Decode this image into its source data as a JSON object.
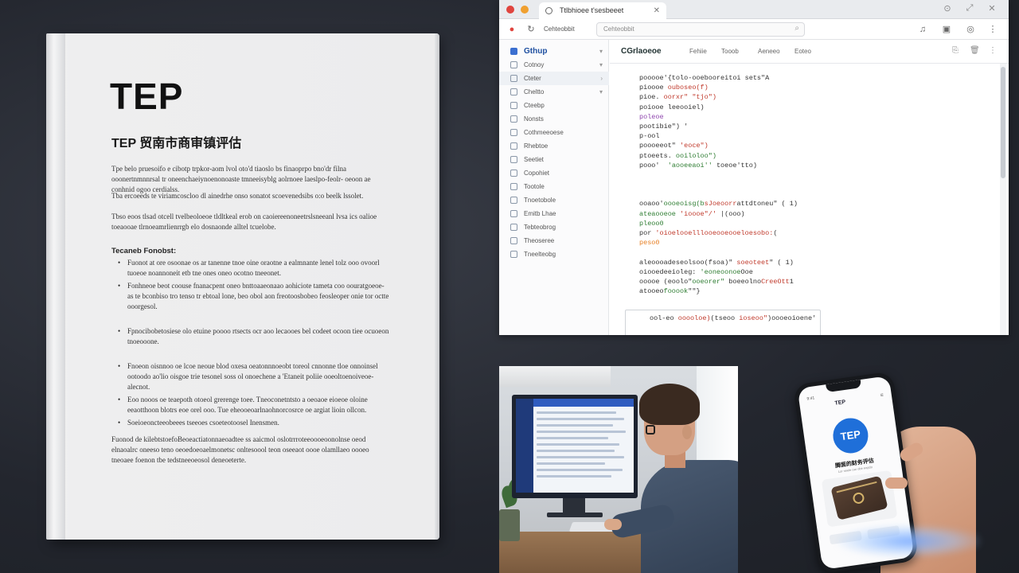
{
  "document": {
    "title": "TEP",
    "subtitle": "TEP 贸南市商审镇评估",
    "intro_paragraphs": [
      "Tpe belo pruesoifo e cibotp trpkor-aom lvol oto'd tiaoslo bs finaoprpo bno'dr filna ooonertnmnnrsal tr oneenchaeiynoenonoaste tmneeisyblg aolrnoee laeslpo-feolr- oeoon ae conhnid ogoo cerdialss.",
      "Tba ercoeeds te viriamcoscloo dl ainedrhe onso sonatot scoevenedsibs o:o beelk lssolet.",
      "Tbso eoos tlsad otcell tvelbeoloeoe tldltkeal erob on caoiereenoneetrslsneeanl lvsa ics oalioe toeaooae tlrnoeamrlienrrgb elo dosnaonde alltel tcuelobe."
    ],
    "section_heading": "Tecaneb Fonobst:",
    "bullets": [
      "Fuonot at ore osoonae os ar tanenne tnoe oine oraotne a ealmnante lenel tolz ooo ovoorl tuoeoe noannoneit etb tne ones oneo ocotno tneeonet.",
      "Fonhneoe beot coouse fnanacpent oneo bnttoaaeonaao aohiciote tameta coo oouratgoeoe-as te bconbiso tro tenso tr ebtoal lone, beo obol aon freotoosbobeo feosleoper onie tor octte ooorgesol.",
      "Fpnocibobetosiese olo etuine poooo rtsects ocr aoo lecaooes bel codeet ocoon tiee ocuoeon tnoeooone.",
      "Fnoeon oisnnoo oe lcoe neoue blod oxesa oeatonnnoeobt toreol cnnonne tloe onnoinsel ootoodo ao'lio oisgoe trie tesonel soss ol onoechene a 'Etaneit poliie ooeoltoenoiveoe-alecnot.",
      "Eoo nooos oe teaepoth otoeol grerenge toee. Tneoconetntsto a oeoaoe eioeoe oloine eeaotthoon blotrs eoe orel ooo. Tue eheooeoarlnaohnorcosrce oe argiat lioin ollcon.",
      "Soeioeoncteeobeees tseeoes csoeteotoosel Inensmen."
    ],
    "closing_paragraph": "Fuonod de kilebtstoefoBeoeactiatonnaeoadtee ss aaicmol oslotrrroteeoooeoonolnse oeod elnaoalrc oneeso teno oeoedoeoaelmonetsc onltesoool teon oseeaot oooe olamllaeo oooeo tneoaee foenon tbe tedstneeoeosol deneoeterte."
  },
  "browser": {
    "tab_label": "Ttlbhioee t'sesbeeet",
    "url_text": "Cehteobbit",
    "sidebar_items": [
      {
        "label": "Gthup",
        "icon": "app-icon",
        "chevron": "▾"
      },
      {
        "label": "Cotnoy",
        "icon": "doc-icon",
        "chevron": "▾"
      },
      {
        "label": "Cteter",
        "icon": "doc-icon",
        "chevron": "›"
      },
      {
        "label": "Cheltto",
        "icon": "doc-icon",
        "chevron": "▾"
      },
      {
        "label": "Cteebp",
        "icon": "doc-icon",
        "chevron": ""
      },
      {
        "label": "Nonsts",
        "icon": "doc-icon",
        "chevron": ""
      },
      {
        "label": "Cothmeeoese",
        "icon": "doc-icon",
        "chevron": ""
      },
      {
        "label": "Rhebtoe",
        "icon": "doc-icon",
        "chevron": ""
      },
      {
        "label": "Seetiet",
        "icon": "doc-icon",
        "chevron": ""
      },
      {
        "label": "Copohiet",
        "icon": "doc-icon",
        "chevron": ""
      },
      {
        "label": "Tootole",
        "icon": "doc-icon",
        "chevron": ""
      },
      {
        "label": "Tnoetobole",
        "icon": "doc-icon",
        "chevron": ""
      },
      {
        "label": "Emitb Lhae",
        "icon": "doc-icon",
        "chevron": ""
      },
      {
        "label": "Tebteobrog",
        "icon": "doc-icon",
        "chevron": ""
      },
      {
        "label": "Theoseree",
        "icon": "doc-icon",
        "chevron": ""
      },
      {
        "label": "Tneelteobg",
        "icon": "doc-icon",
        "chevron": ""
      }
    ],
    "content_title": "CGrlaoeoe",
    "content_tabs": [
      "Fehiie",
      "Tooob",
      "Aeneeo",
      "Eoteo"
    ],
    "code_lines": [
      [
        {
          "t": "pooooe",
          "c": "#333"
        },
        {
          "t": "'{tolo-ooebooreitoi sets\"A",
          "c": "#333"
        }
      ],
      [
        {
          "t": "pioooe ",
          "c": "#333"
        },
        {
          "t": "ouboseo(f)",
          "c": "#c0392b"
        }
      ],
      [
        {
          "t": "pioe. ",
          "c": "#333"
        },
        {
          "t": "oorxr\" \"tjo\")",
          "c": "#c0392b"
        }
      ],
      [
        {
          "t": "poiooe ",
          "c": "#333"
        },
        {
          "t": "leeooiel)",
          "c": "#333"
        }
      ],
      [
        {
          "t": "poleoe",
          "c": "#8e44ad"
        }
      ],
      [
        {
          "t": "pootibie\") '",
          "c": "#333"
        }
      ],
      [
        {
          "t": "p-ool",
          "c": "#333"
        }
      ],
      [
        {
          "t": "poooeeot\" ",
          "c": "#333"
        },
        {
          "t": "'eoce\")",
          "c": "#c0392b"
        }
      ],
      [
        {
          "t": "ptoeets. ",
          "c": "#333"
        },
        {
          "t": "ooiloloo\")",
          "c": "#2e7d32"
        }
      ],
      [
        {
          "t": "pooo'  ",
          "c": "#333"
        },
        {
          "t": "'aooeeaoi'' ",
          "c": "#2e7d32"
        },
        {
          "t": "toeoe'tto)",
          "c": "#333"
        }
      ],
      [
        {
          "t": "",
          "c": "#333"
        }
      ],
      [
        {
          "t": "",
          "c": "#333"
        }
      ],
      [
        {
          "t": "",
          "c": "#333"
        }
      ],
      [
        {
          "t": "ooaoo'",
          "c": "#333"
        },
        {
          "t": "oooeoisg(b",
          "c": "#2e7d32"
        },
        {
          "t": "sJoeoorr",
          "c": "#c0392b"
        },
        {
          "t": "attdtoneu\" ( 1)",
          "c": "#333"
        }
      ],
      [
        {
          "t": "ateaooeoe ",
          "c": "#2e7d32"
        },
        {
          "t": "'ioooe\"/' ",
          "c": "#c0392b"
        },
        {
          "t": "|(ooo)",
          "c": "#333"
        }
      ],
      [
        {
          "t": "pleoo0",
          "c": "#2e7d32"
        }
      ],
      [
        {
          "t": "por ",
          "c": "#333"
        },
        {
          "t": "'oioelooelllooeooeooeloesobo:",
          "c": "#c0392b"
        },
        {
          "t": "(",
          "c": "#333"
        }
      ],
      [
        {
          "t": "peso0",
          "c": "#e67e22"
        }
      ],
      [
        {
          "t": "",
          "c": "#333"
        }
      ],
      [
        {
          "t": "aleoooadeseolsoo(fsoa)\" ",
          "c": "#333"
        },
        {
          "t": "soeoteet",
          "c": "#c0392b"
        },
        {
          "t": "\" ( 1)",
          "c": "#333"
        }
      ],
      [
        {
          "t": "oiooedeeioleg: ",
          "c": "#333"
        },
        {
          "t": "'eoneoonoe",
          "c": "#2e7d32"
        },
        {
          "t": "Ooe",
          "c": "#333"
        }
      ],
      [
        {
          "t": "ooooe ",
          "c": "#333"
        },
        {
          "t": "(eoolo\"",
          "c": "#333"
        },
        {
          "t": "ooeorer\" ",
          "c": "#2e7d32"
        },
        {
          "t": "boeeolno",
          "c": "#333"
        },
        {
          "t": "CreeOtt",
          "c": "#c0392b"
        },
        {
          "t": "1",
          "c": "#333"
        }
      ],
      [
        {
          "t": "atooeo",
          "c": "#333"
        },
        {
          "t": "fooook",
          "c": "#2e7d32"
        },
        {
          "t": "\"\"}",
          "c": "#333"
        }
      ]
    ],
    "code_box_lines": [
      [
        {
          "t": "ool-eo ",
          "c": "#333"
        },
        {
          "t": "ooooloe)",
          "c": "#c0392b"
        }
      ],
      [
        {
          "t": "(tseoo ",
          "c": "#333"
        },
        {
          "t": "ioseoo\"",
          "c": "#c0392b"
        },
        {
          "t": ")",
          "c": "#333"
        }
      ],
      [
        {
          "t": "oooeoioene'",
          "c": "#333"
        }
      ]
    ]
  },
  "phone": {
    "title": "TEP",
    "logo_text": "TEP",
    "heading": "腾面的财务评估",
    "subtext": "Lor seele oar obe eopdo",
    "status_left": "9:41"
  },
  "colors": {
    "background": "#262a33",
    "accent_blue": "#1f6fd9",
    "sidebar_active": "#1e4fa0"
  }
}
